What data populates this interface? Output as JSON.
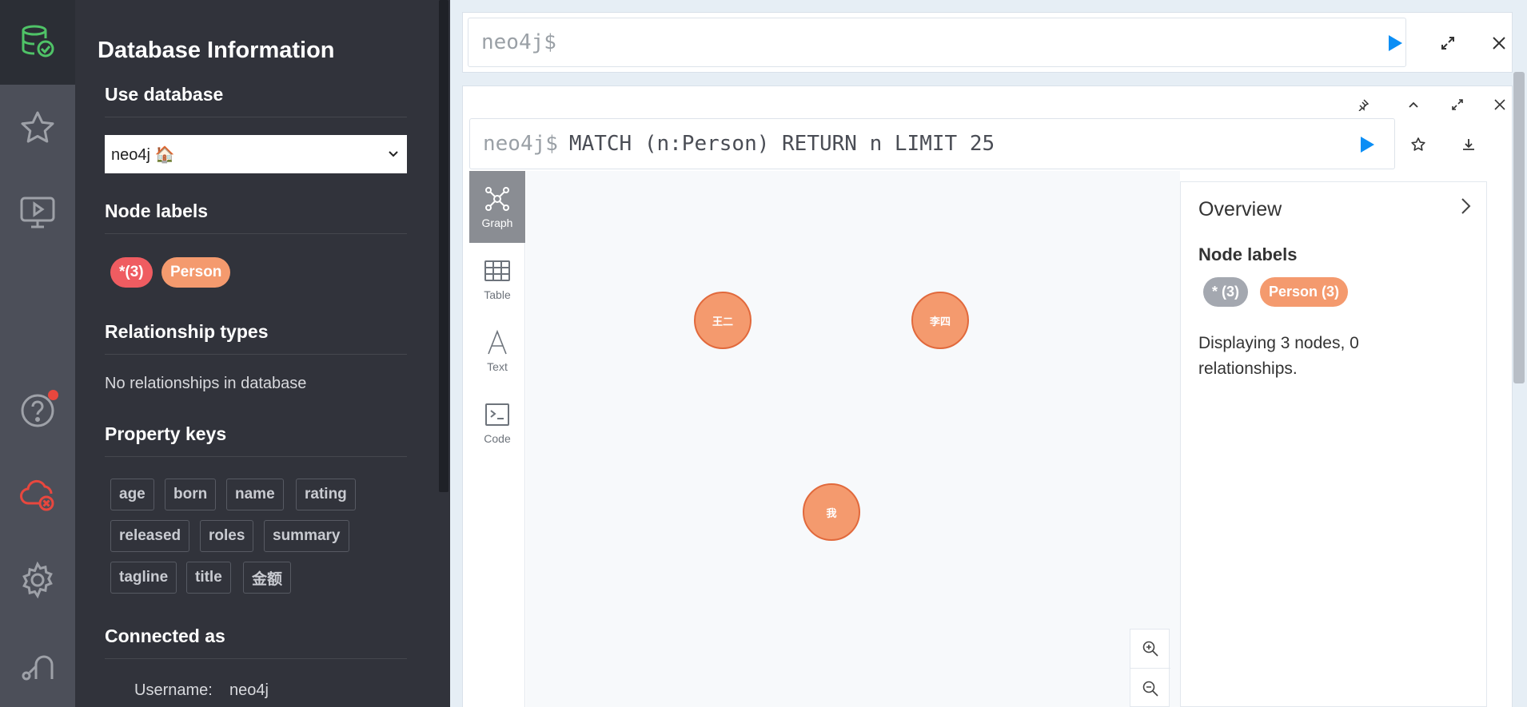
{
  "sidebar": {
    "title": "Database Information",
    "use_database": {
      "heading": "Use database",
      "selected": "neo4j 🏠"
    },
    "node_labels": {
      "heading": "Node labels",
      "items": [
        "*(3)",
        "Person"
      ]
    },
    "relationship_types": {
      "heading": "Relationship types",
      "empty_text": "No relationships in database"
    },
    "property_keys": {
      "heading": "Property keys",
      "items": [
        "age",
        "born",
        "name",
        "rating",
        "released",
        "roles",
        "summary",
        "tagline",
        "title",
        "金额"
      ]
    },
    "connected_as": {
      "heading": "Connected as",
      "username_label": "Username:",
      "username_value": "neo4j"
    }
  },
  "rail": {
    "icons": [
      "database-icon",
      "star-icon",
      "play-screen-icon",
      "help-icon",
      "cloud-disconnected-icon",
      "gear-icon",
      "neo4j-logo-icon"
    ]
  },
  "top_editor": {
    "prompt": "neo4j$"
  },
  "result_frame": {
    "prompt": "neo4j$",
    "query": "MATCH (n:Person) RETURN n LIMIT 25",
    "view_tabs": [
      "Graph",
      "Table",
      "Text",
      "Code"
    ],
    "active_tab": "Graph",
    "nodes": [
      "王二",
      "李四",
      "我"
    ]
  },
  "overview": {
    "title": "Overview",
    "node_labels_heading": "Node labels",
    "labels": [
      "* (3)",
      "Person (3)"
    ],
    "summary": "Displaying 3 nodes, 0 relationships."
  },
  "colors": {
    "accent_blue": "#0b8ef5",
    "person_label": "#f49a6e",
    "all_label_sidebar": "#ef5c61",
    "all_label_overview": "#a4a8b0",
    "notification": "#e8473e",
    "db_icon_green": "#4fc367"
  }
}
